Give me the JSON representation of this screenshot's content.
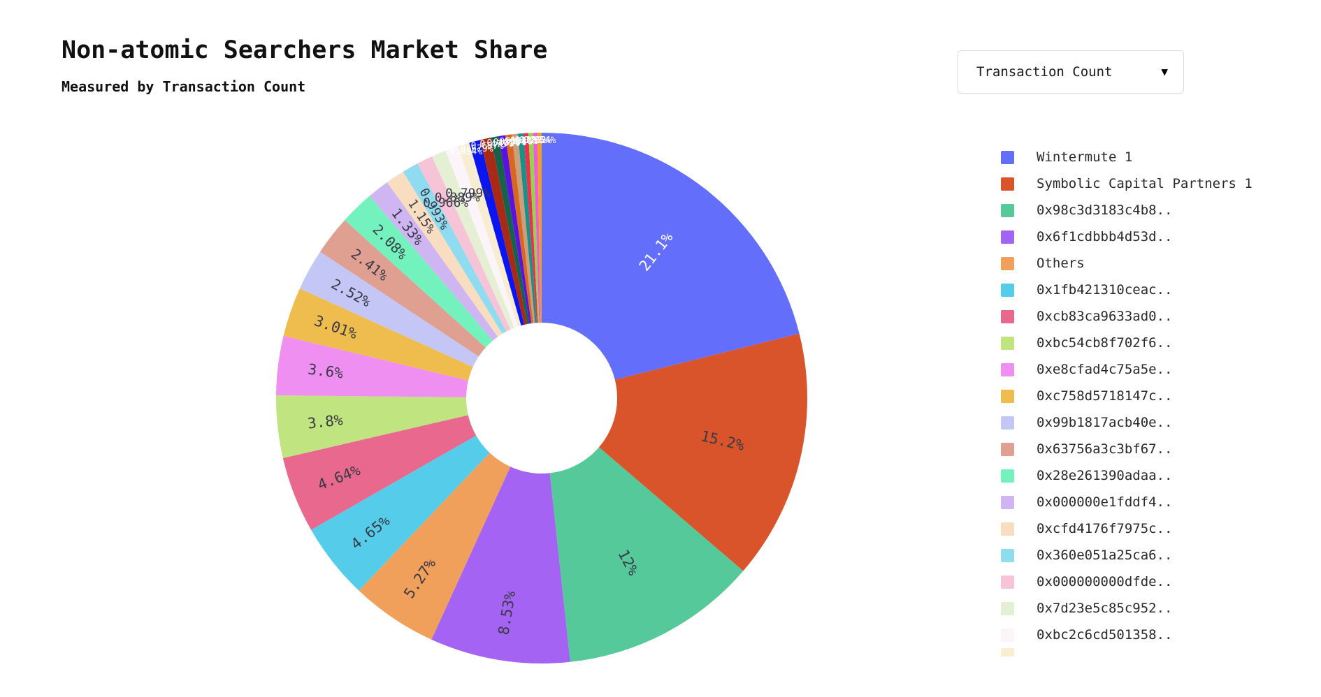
{
  "header": {
    "title": "Non-atomic Searchers Market Share",
    "subtitle": "Measured by Transaction Count"
  },
  "controls": {
    "metric_dropdown": {
      "selected": "Transaction Count",
      "arrow_glyph": "▼",
      "options": [
        "Transaction Count"
      ]
    }
  },
  "chart_data": {
    "type": "pie",
    "variant": "donut",
    "title": "Non-atomic Searchers Market Share",
    "subtitle": "Measured by Transaction Count",
    "value_unit": "percent",
    "hole": 0.28,
    "legend_position": "right",
    "categories": [
      "Wintermute 1",
      "Symbolic Capital Partners 1",
      "0x98c3d3183c4b8..",
      "0x6f1cdbbb4d53d..",
      "Others",
      "0x1fb421310ceac..",
      "0xcb83ca9633ad0..",
      "0xbc54cb8f702f6..",
      "0xe8cfad4c75a5e..",
      "0xc758d5718147c..",
      "0x99b1817acb40e..",
      "0x63756a3c3bf67..",
      "0x28e261390adaa..",
      "0x000000e1fddf4..",
      "0xcfd4176f7975c..",
      "0x360e051a25ca6..",
      "0x000000000dfde..",
      "0x7d23e5c85c952..",
      "0xbc2c6cd501358.."
    ],
    "values": [
      21.1,
      15.2,
      12.0,
      8.53,
      5.27,
      4.65,
      4.64,
      3.8,
      3.6,
      3.01,
      2.52,
      2.41,
      2.08,
      1.33,
      1.15,
      0.993,
      0.966,
      0.889,
      0.799
    ],
    "colors": [
      "#636efa",
      "#d9542b",
      "#56c99a",
      "#a463f2",
      "#f0a05a",
      "#55cdea",
      "#e8698d",
      "#c0e47f",
      "#ef8ff2",
      "#efbc4e",
      "#c4c7f5",
      "#dfa091",
      "#73f2bd",
      "#cfb6f2",
      "#f8ddc0",
      "#8fdcf0",
      "#f7c3d6",
      "#e4efd4",
      "#fbf4f8"
    ],
    "slice_labels": [
      "21.1%",
      "15.2%",
      "12%",
      "8.53%",
      "5.27%",
      "4.65%",
      "4.64%",
      "3.8%",
      "3.6%",
      "3.01%",
      "2.52%",
      "2.41%",
      "2.08%",
      "1.33%",
      "1.15%",
      "0.993%",
      "0.966%",
      "0.889%",
      "0.799%"
    ],
    "small_slices": {
      "note": "thin slivers between the 0.799% slice and the 21.1% slice",
      "labels": [
        "0.694%",
        "0.679%",
        "0.657%",
        "0.475%",
        "0.401%",
        "0.398%",
        "0.361%",
        "0.348%",
        "0.283%",
        "0.282%",
        "0.262%",
        "0.254%"
      ],
      "values": [
        0.694,
        0.679,
        0.657,
        0.475,
        0.401,
        0.398,
        0.361,
        0.348,
        0.283,
        0.282,
        0.262,
        0.254
      ],
      "colors": [
        "#f7edd2",
        "#0a15ef",
        "#a82a16",
        "#17624a",
        "#5a12e0",
        "#d9671f",
        "#cb9f7c",
        "#1a9188",
        "#ef2d4e",
        "#8fd64b",
        "#ef5bd8",
        "#efa11c"
      ]
    },
    "legend_extra": [
      {
        "label": "",
        "color": "#faeed0",
        "clipped": true
      }
    ]
  }
}
